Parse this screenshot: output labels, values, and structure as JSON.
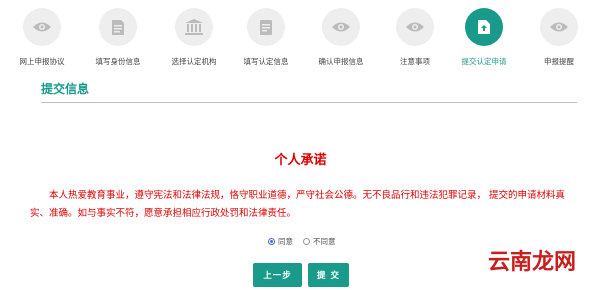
{
  "steps": [
    {
      "label": "网上申报协议",
      "icon": "eye-icon"
    },
    {
      "label": "填写身份信息",
      "icon": "document-icon"
    },
    {
      "label": "选择认定机构",
      "icon": "institution-icon"
    },
    {
      "label": "填写认定信息",
      "icon": "form-icon"
    },
    {
      "label": "确认申报信息",
      "icon": "eye-icon"
    },
    {
      "label": "注意事项",
      "icon": "eye-icon"
    },
    {
      "label": "提交认定申请",
      "icon": "submit-icon"
    },
    {
      "label": "申报提醒",
      "icon": "eye-icon"
    }
  ],
  "active_step": 6,
  "section_title": "提交信息",
  "promise": {
    "title": "个人承诺",
    "text": "本人热爱教育事业，遵守宪法和法律法规，恪守职业道德，严守社会公德。无不良品行和违法犯罪记录， 提交的申请材料真实、准确。如与事实不符，愿意承担相应行政处罚和法律责任。"
  },
  "agreement": {
    "agree_label": "同意",
    "disagree_label": "不同意",
    "selected": "agree"
  },
  "buttons": {
    "prev_label": "上一步",
    "submit_label": "提 交"
  },
  "watermark": "云南龙网",
  "colors": {
    "accent": "#1a9a8a",
    "promise_text": "#e00000",
    "inactive_circle": "#eeeeee"
  }
}
